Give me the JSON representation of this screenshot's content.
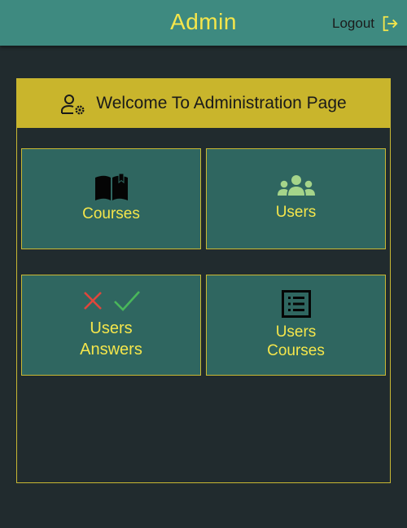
{
  "header": {
    "title": "Admin",
    "logout_label": "Logout"
  },
  "panel": {
    "title": "Welcome To Administration Page"
  },
  "tiles": [
    {
      "label": "Courses",
      "icon": "book-icon"
    },
    {
      "label": "Users",
      "icon": "people-group-icon"
    },
    {
      "label_line1": "Users",
      "label_line2": "Answers",
      "icon": "cross-check-icon"
    },
    {
      "label_line1": "Users",
      "label_line2": "Courses",
      "icon": "list-icon"
    }
  ],
  "colors": {
    "background": "#212b2e",
    "topbar": "#3e8a80",
    "accent_yellow": "#f5e64b",
    "panel_header": "#c9b52c",
    "tile": "#2f6660",
    "cross_red": "#e0463c",
    "check_green": "#49b75a",
    "people_green": "#a5d48a"
  }
}
